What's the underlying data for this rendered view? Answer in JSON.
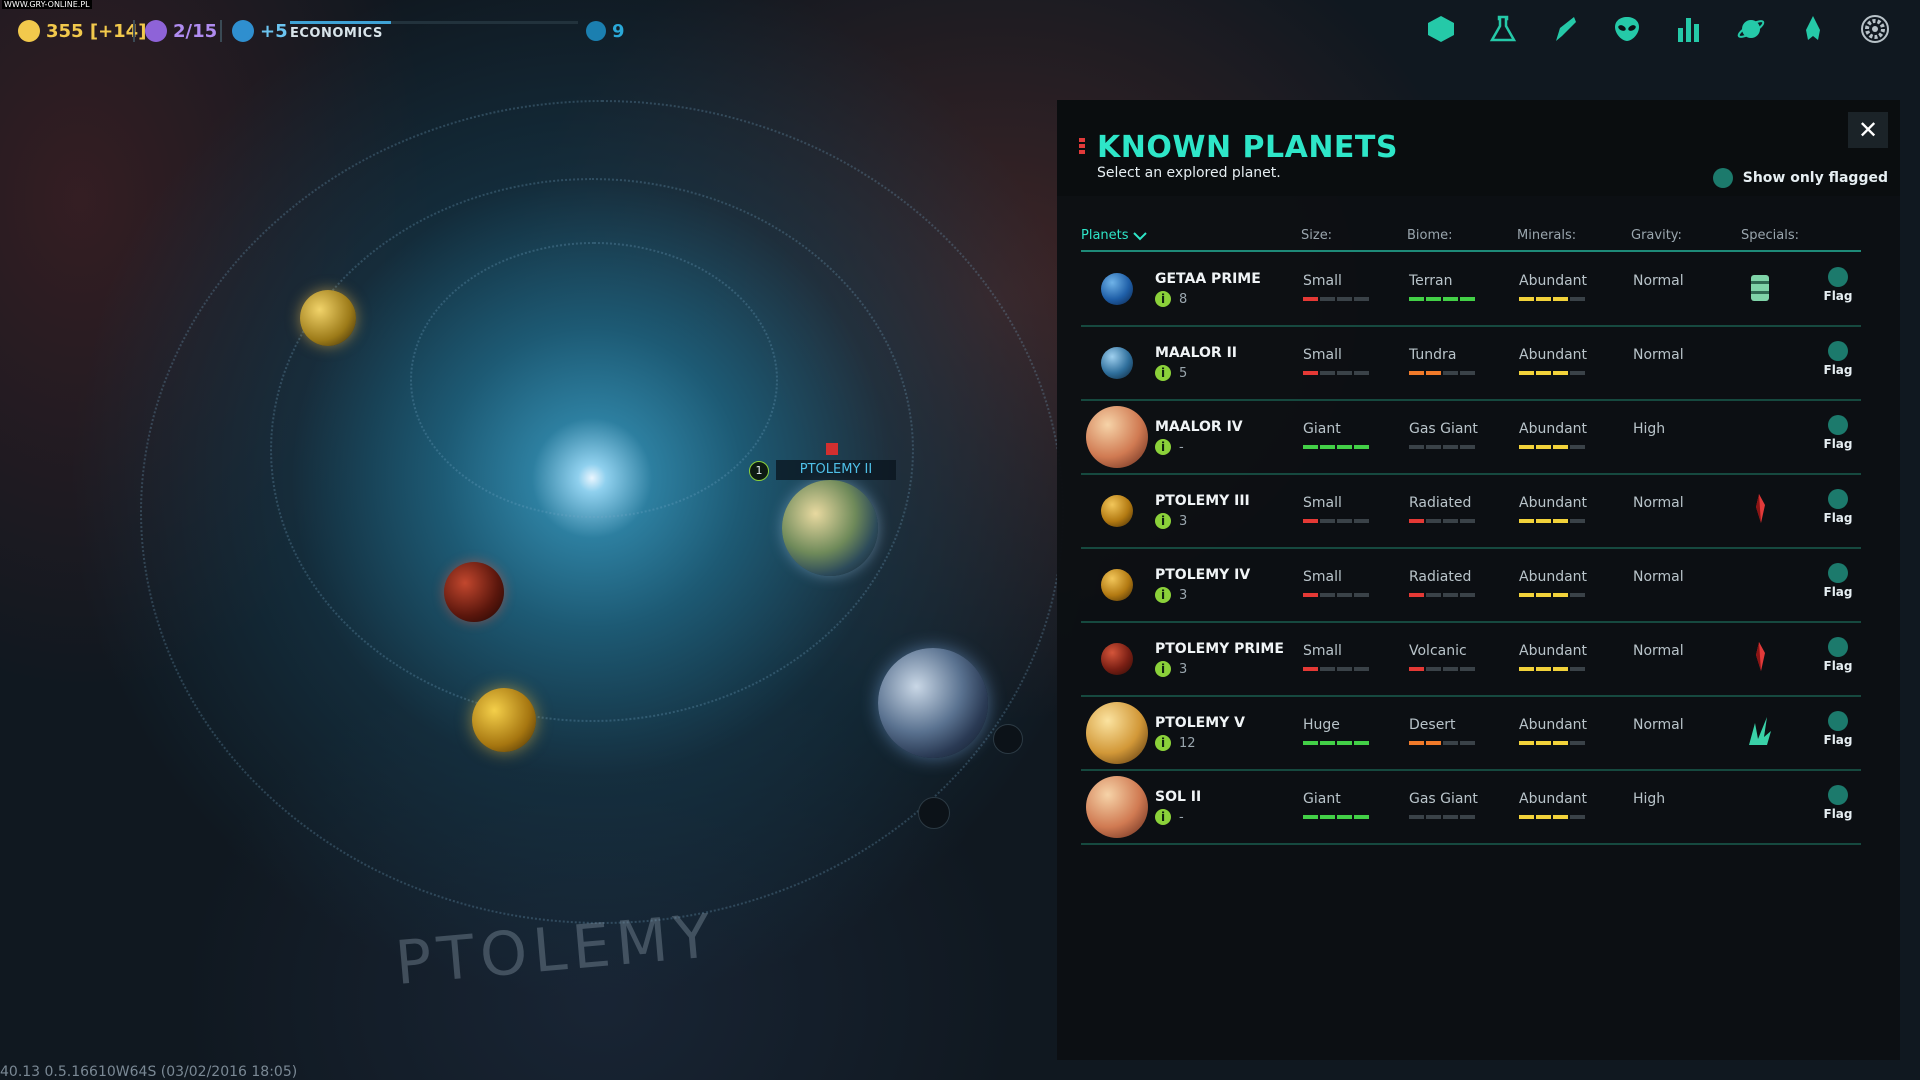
{
  "watermark": "WWW.GRY-ONLINE.PL",
  "topbar": {
    "credits": "355 [+14]",
    "influence": "2/15",
    "research": "+5",
    "research_label": "ECONOMICS",
    "research_progress": 0.35,
    "turns": "9",
    "icons": [
      "empire-icon",
      "research-flask-icon",
      "military-icon",
      "alien-races-icon",
      "statistics-icon",
      "planets-icon",
      "ship-icon",
      "settings-gear-icon"
    ]
  },
  "map": {
    "system_name": "PTOLEMY",
    "selected_planet_label": "PTOLEMY II",
    "selected_planet_pop": "1",
    "coords": "40.13  0.5.16610W64S   (03/02/2016 18:05)"
  },
  "panel": {
    "title": "KNOWN PLANETS",
    "subtitle": "Select an explored planet.",
    "close_label": "✕",
    "show_flagged_label": "Show only flagged",
    "columns": {
      "planets": "Planets",
      "size": "Size:",
      "biome": "Biome:",
      "minerals": "Minerals:",
      "gravity": "Gravity:",
      "specials": "Specials:"
    },
    "flag_label": "Flag",
    "rows": [
      {
        "name": "GETAA PRIME",
        "pop": "8",
        "size": "Small",
        "size_level": 1,
        "size_color": "#e53935",
        "biome": "Terran",
        "biome_level": 4,
        "biome_color": "#43d047",
        "minerals": "Abundant",
        "minerals_level": 3,
        "minerals_color": "#f2d23a",
        "gravity": "Normal",
        "special": "canister-icon",
        "planet_colors": [
          "#6fb3e8",
          "#1f5fa8",
          "#0b2347"
        ]
      },
      {
        "name": "MAALOR II",
        "pop": "5",
        "size": "Small",
        "size_level": 1,
        "size_color": "#e53935",
        "biome": "Tundra",
        "biome_level": 2,
        "biome_color": "#f07a2a",
        "minerals": "Abundant",
        "minerals_level": 3,
        "minerals_color": "#f2d23a",
        "gravity": "Normal",
        "special": "",
        "planet_colors": [
          "#9fd0ef",
          "#2f6f9c",
          "#0c2236"
        ]
      },
      {
        "name": "MAALOR IV",
        "pop": "-",
        "size": "Giant",
        "size_level": 4,
        "size_color": "#43d047",
        "biome": "Gas Giant",
        "biome_level": 0,
        "biome_color": "#f07a2a",
        "minerals": "Abundant",
        "minerals_level": 3,
        "minerals_color": "#f2d23a",
        "gravity": "High",
        "special": "",
        "planet_colors": [
          "#f6d3a8",
          "#d07a52",
          "#5a2418"
        ]
      },
      {
        "name": "PTOLEMY III",
        "pop": "3",
        "size": "Small",
        "size_level": 1,
        "size_color": "#e53935",
        "biome": "Radiated",
        "biome_level": 1,
        "biome_color": "#e53935",
        "minerals": "Abundant",
        "minerals_level": 3,
        "minerals_color": "#f2d23a",
        "gravity": "Normal",
        "special": "red-crystal-icon",
        "planet_colors": [
          "#f2c65a",
          "#b37a12",
          "#3d2806"
        ]
      },
      {
        "name": "PTOLEMY IV",
        "pop": "3",
        "size": "Small",
        "size_level": 1,
        "size_color": "#e53935",
        "biome": "Radiated",
        "biome_level": 1,
        "biome_color": "#e53935",
        "minerals": "Abundant",
        "minerals_level": 3,
        "minerals_color": "#f2d23a",
        "gravity": "Normal",
        "special": "",
        "planet_colors": [
          "#f2c65a",
          "#b37a12",
          "#3d2806"
        ]
      },
      {
        "name": "PTOLEMY PRIME",
        "pop": "3",
        "size": "Small",
        "size_level": 1,
        "size_color": "#e53935",
        "biome": "Volcanic",
        "biome_level": 1,
        "biome_color": "#e53935",
        "minerals": "Abundant",
        "minerals_level": 3,
        "minerals_color": "#f2d23a",
        "gravity": "Normal",
        "special": "red-crystal-icon",
        "planet_colors": [
          "#d4553a",
          "#7a1f14",
          "#2a0a06"
        ]
      },
      {
        "name": "PTOLEMY V",
        "pop": "12",
        "size": "Huge",
        "size_level": 4,
        "size_color": "#43d047",
        "biome": "Desert",
        "biome_level": 2,
        "biome_color": "#f07a2a",
        "minerals": "Abundant",
        "minerals_level": 3,
        "minerals_color": "#f2d23a",
        "gravity": "Normal",
        "special": "green-crystal-icon",
        "planet_colors": [
          "#fbe3a0",
          "#d29838",
          "#4a2c0a"
        ]
      },
      {
        "name": "SOL II",
        "pop": "-",
        "size": "Giant",
        "size_level": 4,
        "size_color": "#43d047",
        "biome": "Gas Giant",
        "biome_level": 0,
        "biome_color": "#f07a2a",
        "minerals": "Abundant",
        "minerals_level": 3,
        "minerals_color": "#f2d23a",
        "gravity": "High",
        "special": "",
        "planet_colors": [
          "#f6d3a8",
          "#d07a52",
          "#5a2418"
        ]
      }
    ]
  }
}
